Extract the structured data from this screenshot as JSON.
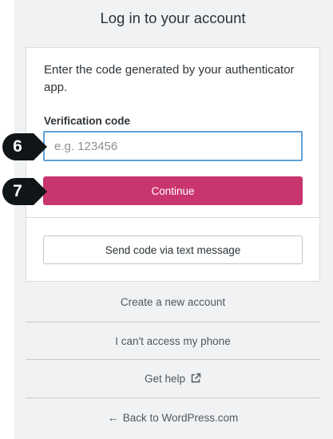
{
  "page": {
    "title": "Log in to your account"
  },
  "form": {
    "instructions": "Enter the code generated by your authenticator app.",
    "code_label": "Verification code",
    "code_placeholder": "e.g. 123456",
    "code_value": "",
    "continue_label": "Continue",
    "send_sms_label": "Send code via text message"
  },
  "links": {
    "create_account": "Create a new account",
    "cant_access_phone": "I can't access my phone",
    "get_help": "Get help",
    "back_to_wordpress": "Back to WordPress.com"
  },
  "icons": {
    "external": "external-link-icon",
    "back": "arrow-left-icon"
  },
  "callouts": {
    "step_6": "6",
    "step_7": "7"
  },
  "colors": {
    "primary_button": "#c9356e",
    "input_focus_border": "#5fa0d6",
    "page_background": "#f1f2f3",
    "callout": "#101517"
  }
}
